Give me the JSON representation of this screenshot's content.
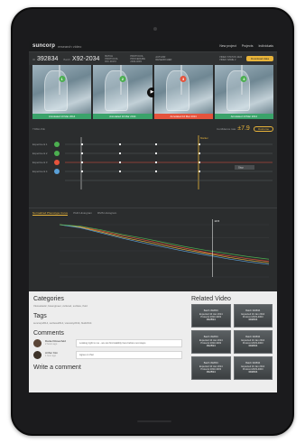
{
  "app": {
    "logo": "suncorp",
    "logo_sub": "research video",
    "nav": [
      "New project",
      "Projects",
      "Individuals"
    ]
  },
  "id_row": {
    "first_label": "ID",
    "first_value": "392834",
    "second_label": "Batch",
    "second_value": "X92-2034",
    "meta_items": [
      {
        "title": "BATCH PROTOCOL",
        "value": "DIC 40172"
      },
      {
        "title": "PROTOCOL PROCEDURE",
        "value": "2033-4003"
      },
      {
        "title": "AUTHOR",
        "value": "RESEARCHER"
      }
    ],
    "right_meta": "VIDEO STATUS 1024 VIDEO NAME 2",
    "download_label": "Download data"
  },
  "thumbnails": [
    {
      "badge": "1",
      "badge_color": "#4caf50",
      "label_color": "#3aa36a",
      "label": "Annotated 10 Mar 2014"
    },
    {
      "badge": "2",
      "badge_color": "#4caf50",
      "label_color": "#3aa36a",
      "label": "Annotated 10 Mar 2014"
    },
    {
      "badge": "3",
      "badge_color": "#e5533c",
      "label_color": "#e5533c",
      "label": "Annotated 10 Mar 2014"
    },
    {
      "badge": "4",
      "badge_color": "#4caf50",
      "label_color": "#3aa36a",
      "label": "Annotated 10 Mar 2014"
    }
  ],
  "play_icon": "play-icon",
  "timeline": {
    "section_label": "TIMELINE",
    "confidence_label": "Confidence rate",
    "score": "±7.9",
    "pill_label": "Outcome",
    "rows": [
      {
        "label": "Experiment 1",
        "color": "#4caf50"
      },
      {
        "label": "Experiment 2",
        "color": "#4caf50"
      },
      {
        "label": "Experiment 3",
        "color": "#e5533c"
      },
      {
        "label": "Experiment 4",
        "color": "#5aa0d8"
      }
    ],
    "marker_label": "Marker",
    "stop_label": "Stop"
  },
  "chart_tabs": [
    "Normalized Phenotype Curve",
    "PHD Histogram",
    "RMS Histogram"
  ],
  "chart_data": {
    "type": "line",
    "x": [
      0,
      1,
      2,
      3,
      4,
      5,
      6,
      7,
      8,
      9,
      10
    ],
    "series": [
      {
        "values": [
          100,
          96,
          88,
          79,
          71,
          63,
          55,
          47,
          41,
          35,
          30
        ],
        "color": "#e5533c"
      },
      {
        "values": [
          100,
          95,
          86,
          76,
          68,
          60,
          52,
          45,
          38,
          32,
          27
        ],
        "color": "#e8b43a"
      },
      {
        "values": [
          100,
          94,
          84,
          74,
          65,
          57,
          49,
          42,
          35,
          29,
          24
        ],
        "color": "#5aa0d8"
      },
      {
        "values": [
          100,
          97,
          90,
          81,
          74,
          66,
          58,
          51,
          45,
          39,
          34
        ],
        "color": "#4caf50"
      }
    ],
    "marker_label": "10.5",
    "ylim": [
      0,
      100
    ],
    "grid": true
  },
  "categories": {
    "title": "Categories",
    "items": "Viscoelastic, bioengineer, cultured, surface, fluid"
  },
  "tags": {
    "title": "Tags",
    "items": "suncorp2014, surface2014, viscosity2014, fluid2014"
  },
  "comments": {
    "title": "Comments",
    "list": [
      {
        "name": "Daniel Rosenfeld",
        "time": "2 hours ago",
        "text": "Looking right to me - we can find stability here before next steps"
      },
      {
        "name": "Arthur Kim",
        "time": "1 hour ago",
        "text": "Agree on that"
      }
    ],
    "write_label": "Write a comment"
  },
  "related": {
    "title": "Related Video",
    "items": [
      {
        "l1": "Batch 392834",
        "l2": "Expected 10 Jan 2014",
        "l3": "Protocol 2033-4003",
        "num": "392834"
      },
      {
        "l1": "Batch 392834",
        "l2": "Expected 10 Jan 2014",
        "l3": "Protocol 2033-4003",
        "num": "392834"
      },
      {
        "l1": "Batch 392834",
        "l2": "Expected 10 Jan 2014",
        "l3": "Protocol 2033-4003",
        "num": "392834"
      },
      {
        "l1": "Batch 392834",
        "l2": "Expected 10 Jan 2014",
        "l3": "Protocol 2033-4003",
        "num": "392834"
      },
      {
        "l1": "Batch 392834",
        "l2": "Expected 10 Jan 2014",
        "l3": "Protocol 2033-4003",
        "num": "392834"
      },
      {
        "l1": "Batch 392834",
        "l2": "Expected 10 Jan 2014",
        "l3": "Protocol 2033-4003",
        "num": "392834"
      }
    ]
  }
}
